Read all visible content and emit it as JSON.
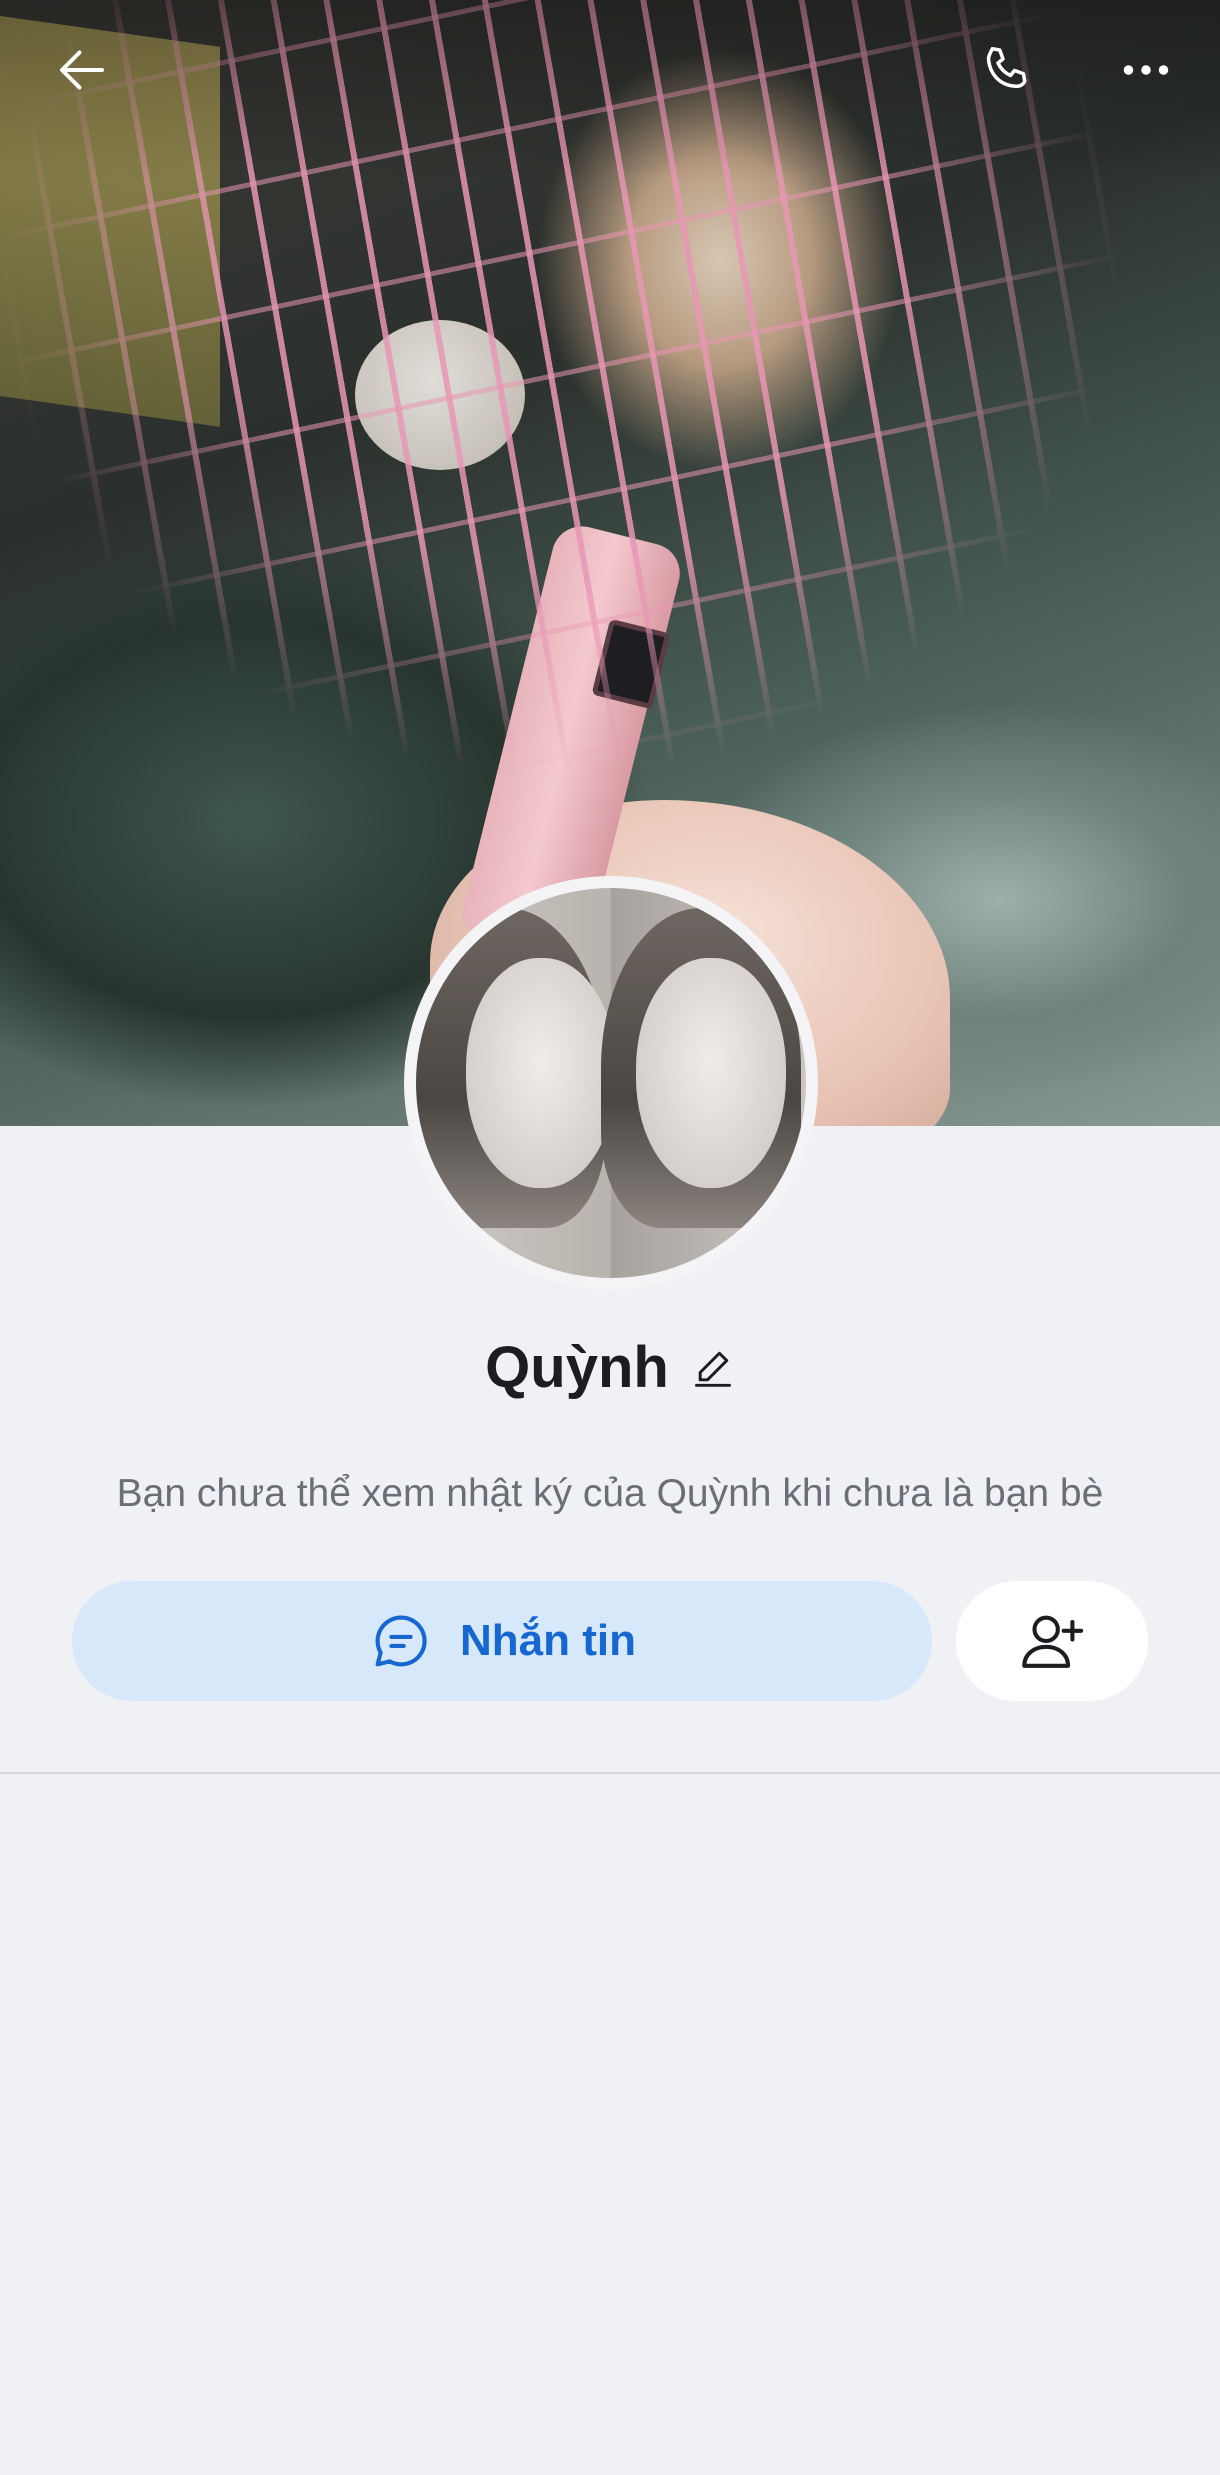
{
  "profile": {
    "name": "Quỳnh",
    "privacy_note": "Bạn chưa thể xem nhật ký của Quỳnh khi chưa là bạn bè"
  },
  "header": {
    "back_icon": "back-arrow-icon",
    "call_icon": "phone-icon",
    "more_icon": "more-dots-icon"
  },
  "actions": {
    "message_label": "Nhắn tin",
    "message_icon": "chat-bubble-icon",
    "add_friend_icon": "add-friend-icon"
  },
  "colors": {
    "accent": "#1767d2",
    "message_button_bg": "#d7e8fb",
    "background": "#eff1f5"
  }
}
